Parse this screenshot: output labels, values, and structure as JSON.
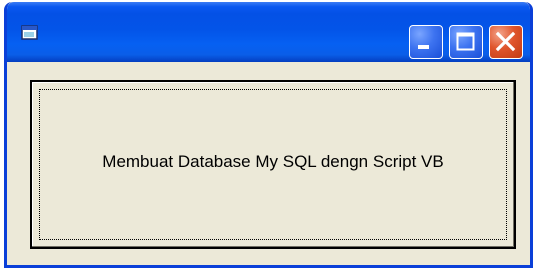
{
  "window": {
    "title": ""
  },
  "titlebar": {
    "icon": "app-window-icon",
    "minimize_icon": "minimize-icon",
    "maximize_icon": "maximize-icon",
    "close_icon": "close-icon",
    "colors": {
      "titlebar": "#0451e6",
      "close_button": "#e0552c"
    }
  },
  "main": {
    "button_label": "Membuat Database My SQL dengn Script VB"
  }
}
